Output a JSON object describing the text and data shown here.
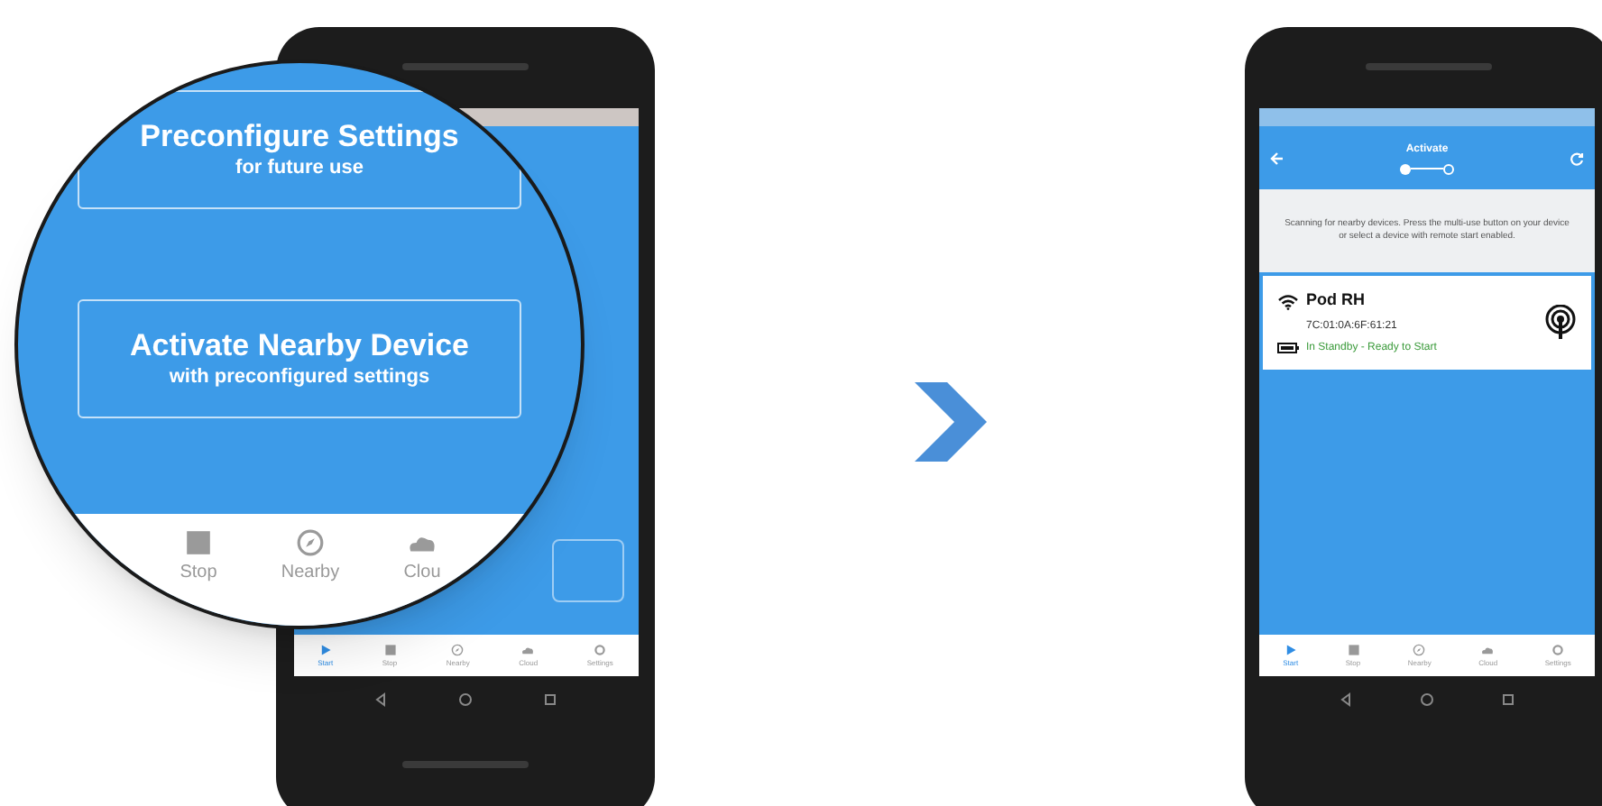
{
  "zoom_view": {
    "buttons": [
      {
        "title": "Preconfigure Settings",
        "subtitle": "for future use"
      },
      {
        "title": "Activate Nearby Device",
        "subtitle": "with preconfigured settings"
      }
    ],
    "nav_items": [
      {
        "label": "Stop",
        "kind": "stop"
      },
      {
        "label": "Nearby",
        "kind": "nearby"
      },
      {
        "label": "Clou",
        "kind": "cloud"
      }
    ]
  },
  "left_phone": {
    "nav_items": [
      {
        "label": "Start",
        "kind": "play",
        "selected": true
      },
      {
        "label": "Stop",
        "kind": "stop",
        "selected": false
      },
      {
        "label": "Nearby",
        "kind": "nearby",
        "selected": false
      },
      {
        "label": "Cloud",
        "kind": "cloud",
        "selected": false
      },
      {
        "label": "Settings",
        "kind": "settings",
        "selected": false
      }
    ]
  },
  "right_phone": {
    "header": {
      "title": "Activate",
      "steps": [
        {
          "selected": true
        },
        {
          "selected": false
        }
      ]
    },
    "message": "Scanning for nearby devices. Press the multi-use button on your device or select a device with remote start enabled.",
    "devices": [
      {
        "name": "Pod RH",
        "address": "7C:01:0A:6F:61:21",
        "status": "In Standby - Ready to Start"
      }
    ],
    "nav_items": [
      {
        "label": "Start",
        "kind": "play",
        "selected": true
      },
      {
        "label": "Stop",
        "kind": "stop",
        "selected": false
      },
      {
        "label": "Nearby",
        "kind": "nearby",
        "selected": false
      },
      {
        "label": "Cloud",
        "kind": "cloud",
        "selected": false
      },
      {
        "label": "Settings",
        "kind": "settings",
        "selected": false
      }
    ]
  }
}
